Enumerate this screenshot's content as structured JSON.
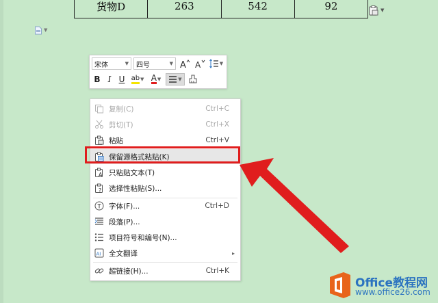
{
  "table_row": [
    "货物D",
    "263",
    "542",
    "92"
  ],
  "mini_toolbar": {
    "font_name": "宋体",
    "font_size": "四号",
    "bold": "B",
    "italic": "I",
    "underline": "U",
    "highlight": "ab",
    "font_color": "A"
  },
  "context_menu": {
    "items": [
      {
        "label": "复制(C)",
        "shortcut": "Ctrl+C",
        "icon": "copy-icon",
        "enabled": false
      },
      {
        "label": "剪切(T)",
        "shortcut": "Ctrl+X",
        "icon": "scissors-icon",
        "enabled": false
      },
      {
        "label": "粘贴",
        "shortcut": "Ctrl+V",
        "icon": "paste-icon",
        "enabled": true
      },
      {
        "label": "保留源格式粘贴(K)",
        "shortcut": "",
        "icon": "paste-keep-format-icon",
        "enabled": true,
        "highlighted": true
      },
      {
        "label": "只粘贴文本(T)",
        "shortcut": "",
        "icon": "paste-text-only-icon",
        "enabled": true
      },
      {
        "label": "选择性粘贴(S)...",
        "shortcut": "",
        "icon": "paste-special-icon",
        "enabled": true
      },
      {
        "label": "字体(F)...",
        "shortcut": "Ctrl+D",
        "icon": "font-icon",
        "enabled": true
      },
      {
        "label": "段落(P)...",
        "shortcut": "",
        "icon": "paragraph-icon",
        "enabled": true
      },
      {
        "label": "项目符号和编号(N)...",
        "shortcut": "",
        "icon": "bullets-numbering-icon",
        "enabled": true
      },
      {
        "label": "全文翻译",
        "shortcut": "",
        "icon": "translate-icon",
        "enabled": true,
        "submenu": true
      },
      {
        "label": "超链接(H)...",
        "shortcut": "Ctrl+K",
        "icon": "hyperlink-icon",
        "enabled": true
      }
    ]
  },
  "watermark": {
    "title": "Office教程网",
    "url": "www.office26.com"
  },
  "colors": {
    "background": "#c7e8c9",
    "highlight_red": "#e01d1d",
    "brand_orange": "#e8641b",
    "brand_blue": "#2b73c0"
  }
}
